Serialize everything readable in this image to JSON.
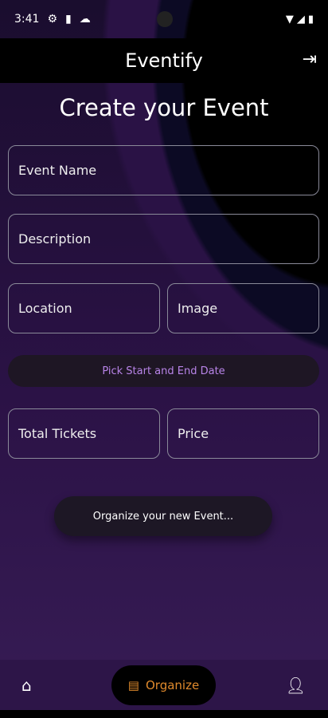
{
  "status": {
    "time": "3:41"
  },
  "appbar": {
    "title": "Eventify",
    "logout_icon": "logout-icon"
  },
  "page": {
    "title": "Create your Event"
  },
  "form": {
    "event_name": "Event Name",
    "description": "Description",
    "location": "Location",
    "image": "Image",
    "pick_dates": "Pick Start and End Date",
    "total_tickets": "Total Tickets",
    "price": "Price",
    "submit": "Organize your new Event..."
  },
  "nav": {
    "organize": "Organize",
    "accent": "#e08a2c"
  }
}
